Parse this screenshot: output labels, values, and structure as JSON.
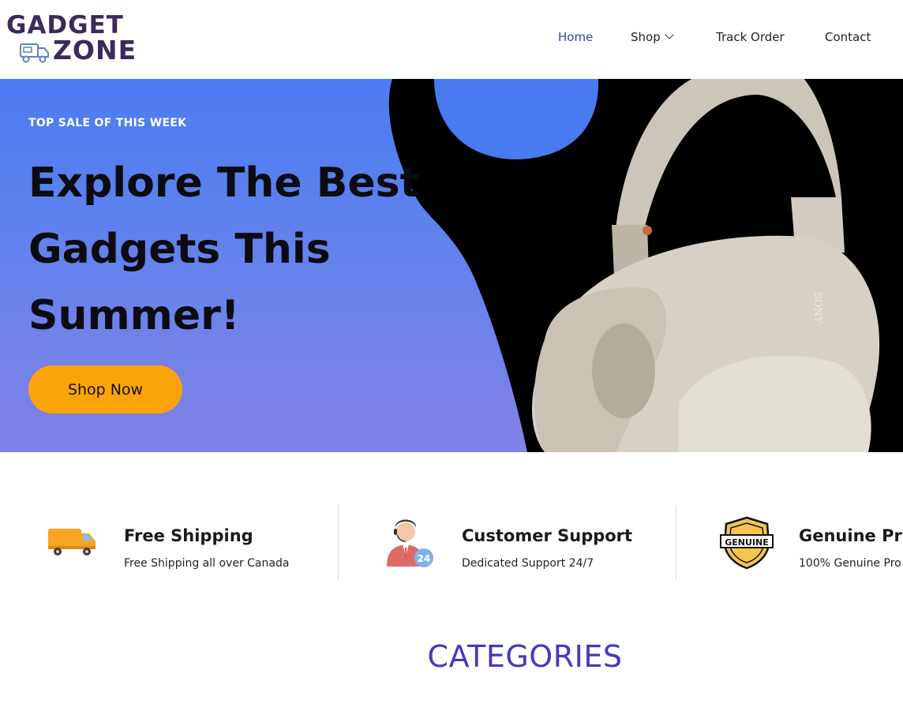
{
  "brand": {
    "line1": "GADGET",
    "line2": "ZONE",
    "color": "#3b2a5c"
  },
  "nav": {
    "home": "Home",
    "shop": "Shop",
    "track_order": "Track Order",
    "contact": "Contact",
    "active_color": "#2b4c8c"
  },
  "hero": {
    "tagline": "TOP SALE OF THIS WEEK",
    "title_line1": "Explore The Best",
    "title_line2": "Gadgets This",
    "title_line3": "Summer!",
    "cta": "Shop Now",
    "cta_color": "#fca30a",
    "bg_color": "#4b7cf1",
    "product_brand": "SONY"
  },
  "features": [
    {
      "title": "Free Shipping",
      "subtitle": "Free Shipping all over Canada",
      "icon": "delivery-truck-icon"
    },
    {
      "title": "Customer Support",
      "subtitle": "Dedicated Support 24/7",
      "icon": "support-agent-icon",
      "badge": "24"
    },
    {
      "title": "Genuine Pr",
      "subtitle": "100% Genuine Pro",
      "icon": "genuine-badge-icon",
      "badge": "GENUINE"
    }
  ],
  "section": {
    "categories_heading": "CATEGORIES",
    "heading_color": "#4338c2"
  }
}
